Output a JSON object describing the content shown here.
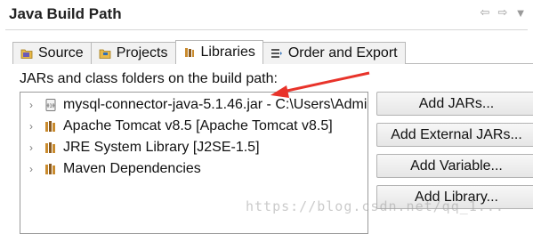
{
  "header": {
    "title": "Java Build Path",
    "nav_icons": [
      "back-arrow-icon",
      "forward-arrow-icon",
      "dropdown-triangle-icon"
    ]
  },
  "tabs": [
    {
      "label": "Source",
      "icon": "source-folder-icon",
      "active": false
    },
    {
      "label": "Projects",
      "icon": "projects-icon",
      "active": false
    },
    {
      "label": "Libraries",
      "icon": "libraries-icon",
      "active": true
    },
    {
      "label": "Order and Export",
      "icon": "order-export-icon",
      "active": false
    }
  ],
  "libraries": {
    "description": "JARs and class folders on the build path:",
    "items": [
      {
        "label": "mysql-connector-java-5.1.46.jar - C:\\Users\\Admi",
        "icon": "jar-icon"
      },
      {
        "label": "Apache Tomcat v8.5 [Apache Tomcat v8.5]",
        "icon": "library-icon"
      },
      {
        "label": "JRE System Library [J2SE-1.5]",
        "icon": "library-icon"
      },
      {
        "label": "Maven Dependencies",
        "icon": "library-icon"
      }
    ],
    "buttons": [
      "Add JARs...",
      "Add External JARs...",
      "Add Variable...",
      "Add Library..."
    ]
  },
  "annotation": {
    "arrow_color": "#e8332a"
  },
  "watermark": "https://blog.csdn.net/qq_1..."
}
